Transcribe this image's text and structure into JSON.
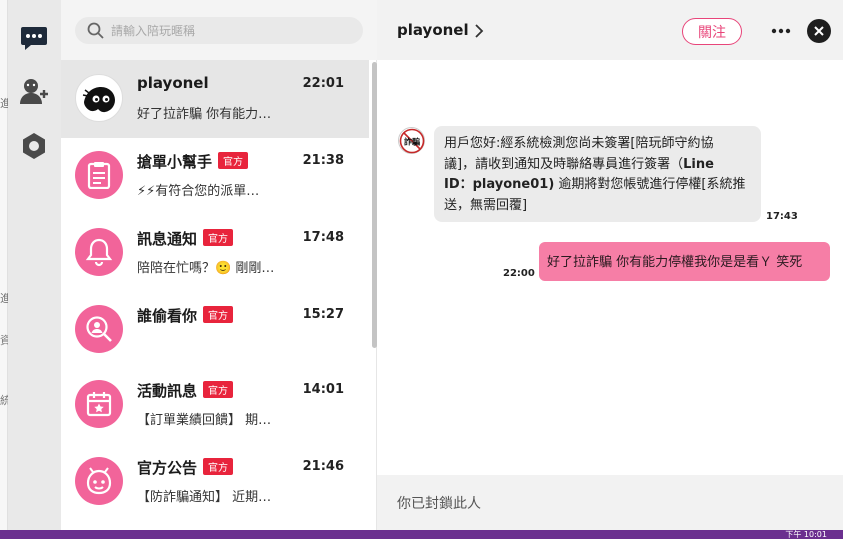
{
  "edge": {
    "glyph_1": "進",
    "glyph_2": "資",
    "glyph_3": "統"
  },
  "rail": [
    {
      "icon": "chat-bubble-icon"
    },
    {
      "icon": "add-user-icon"
    },
    {
      "icon": "hexagon-settings-icon"
    }
  ],
  "search": {
    "placeholder": "請輸入陪玩暱稱",
    "value": ""
  },
  "conversations": [
    {
      "name": "playonel",
      "official": "",
      "time": "22:01",
      "preview": "好了拉詐騙 你有能力…",
      "avatar": "playonel-avatar"
    },
    {
      "name": "搶單小幫手",
      "official": "官方",
      "time": "21:38",
      "preview": "⚡⚡有符合您的派單…",
      "avatar": "clipboard-icon"
    },
    {
      "name": "訊息通知",
      "official": "官方",
      "time": "17:48",
      "preview": "陪陪在忙嗎？🙂 剛剛…",
      "avatar": "bell-icon"
    },
    {
      "name": "誰偷看你",
      "official": "官方",
      "time": "15:27",
      "preview": "",
      "avatar": "magnifier-person-icon"
    },
    {
      "name": "活動訊息",
      "official": "官方",
      "time": "14:01",
      "preview": "【訂單業績回饋】 期…",
      "avatar": "calendar-star-icon"
    },
    {
      "name": "官方公告",
      "official": "官方",
      "time": "21:46",
      "preview": "【防詐騙通知】 近期…",
      "avatar": "mascot-icon"
    }
  ],
  "chat": {
    "title": "playonel",
    "follow_label": "關注",
    "incoming": {
      "line1": "用戶您好:經系統檢測您尚未簽署[陪玩師守約協",
      "line2a": "議]，請收到通知及時聯絡專員進行簽署（",
      "line2b": "Line",
      "line3a": "ID：playone01)",
      "line3b": " 逾期將對您帳號進行停權[系統推",
      "line4": "送，無需回覆]",
      "time": "17:43",
      "avatar_text": "詐騙"
    },
    "outgoing": {
      "text": "好了拉詐騙 你有能力停權我你是是看Ｙ 笑死",
      "time": "22:00"
    },
    "blocked_text": "你已封鎖此人"
  },
  "taskbar": {
    "clock": "下午 10:01"
  },
  "colors": {
    "accent": "#e8457a",
    "pink": "#f2649a",
    "badge": "#e8243c",
    "taskbar": "#6b2f8f"
  }
}
